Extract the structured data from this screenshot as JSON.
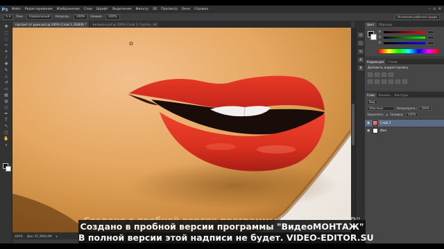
{
  "app": {
    "logo": "Ps",
    "menu": [
      "Файл",
      "Редактирование",
      "Изображение",
      "Слои",
      "Шрифт",
      "Выделение",
      "Фильтр",
      "3D",
      "Просмотр",
      "Окно",
      "Справка"
    ],
    "window_controls": [
      "–",
      "▫",
      "×"
    ]
  },
  "options": {
    "mode_label": "Реж:",
    "mode_value": "Нормальный",
    "opacity_label": "Непрозр.:",
    "opacity_value": "100%",
    "flow_label": "Нажим:",
    "flow_value": "100%",
    "workspace": "Основная рабочая среда"
  },
  "tabs": [
    {
      "label": "портрет от руки.psd @ 200% (Слой 2, RGB/8) *",
      "active": true
    },
    {
      "label": "меломан.psd @ 100% (Слой 3, Группа.../8)",
      "active": false
    }
  ],
  "status": {
    "zoom": "200%",
    "doc": "Док: 67,3M/0,0M"
  },
  "panels": {
    "color_tabs": [
      "Цвет",
      "Образцы"
    ],
    "channels": [
      "R",
      "G",
      "B"
    ],
    "adjust_tabs": [
      "Коррекция",
      "Стили"
    ],
    "adjust_title": "Добавить корректировку",
    "layers_tabs": [
      "Слои",
      "Каналы",
      "Контуры"
    ],
    "kind_label": "Вид",
    "blend_value": "Обычные",
    "opacity_label": "Непрозрачн.:",
    "opacity_value": "100%",
    "lock_label": "Закрепить:",
    "fill_label": "Заливка:",
    "fill_value": "100%",
    "layers": [
      {
        "name": "Слой 2",
        "selected": true
      },
      {
        "name": "Фон",
        "selected": false
      }
    ]
  },
  "watermark": {
    "ghost": "Создано в пробной версии программы \"ВидеоМАСТЕР\"",
    "line1": "Создано в пробной версии программы \"ВидеоМОНТАЖ\"",
    "line2": "В полной версии этой надписи не будет. VIDEO-EDITOR.SU"
  }
}
